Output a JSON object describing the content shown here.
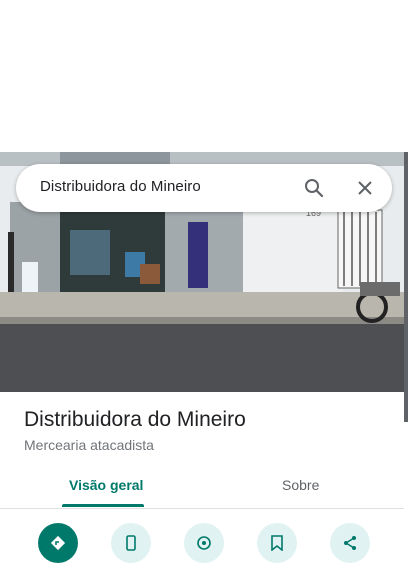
{
  "search": {
    "query": "Distribuidora do Mineiro"
  },
  "place": {
    "name": "Distribuidora do Mineiro",
    "category": "Mercearia atacadista",
    "photo_house_number": "169"
  },
  "tabs": [
    {
      "label": "Visão geral",
      "active": true
    },
    {
      "label": "Sobre",
      "active": false
    }
  ],
  "actions": [
    {
      "icon": "directions-icon",
      "primary": true
    },
    {
      "icon": "phone-icon",
      "primary": false
    },
    {
      "icon": "nearby-icon",
      "primary": false
    },
    {
      "icon": "save-icon",
      "primary": false
    },
    {
      "icon": "share-icon",
      "primary": false
    }
  ],
  "colors": {
    "accent": "#00796b",
    "action_bg": "#e0f2f1",
    "text_primary": "#202124",
    "text_secondary": "#70757a"
  }
}
